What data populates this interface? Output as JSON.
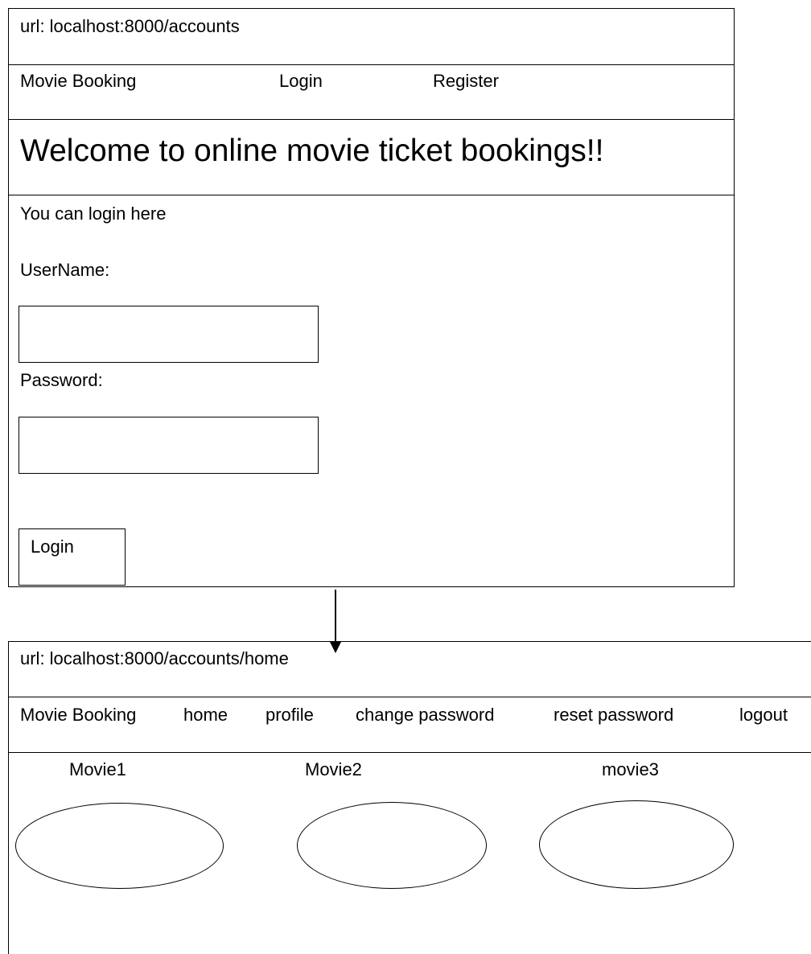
{
  "login_screen": {
    "url": "url: localhost:8000/accounts",
    "nav": {
      "brand": "Movie Booking",
      "login": "Login",
      "register": "Register"
    },
    "welcome_title": "Welcome to online movie ticket bookings!!",
    "intro_text": "You can login here",
    "username_label": "UserName:",
    "username_value": "",
    "password_label": "Password:",
    "password_value": "",
    "login_button": "Login"
  },
  "home_screen": {
    "url": "url: localhost:8000/accounts/home",
    "nav": {
      "brand": "Movie Booking",
      "home": "home",
      "profile": "profile",
      "change_password": "change password",
      "reset_password": "reset password",
      "logout": "logout"
    },
    "movies": [
      "Movie1",
      "Movie2",
      "movie3"
    ]
  }
}
